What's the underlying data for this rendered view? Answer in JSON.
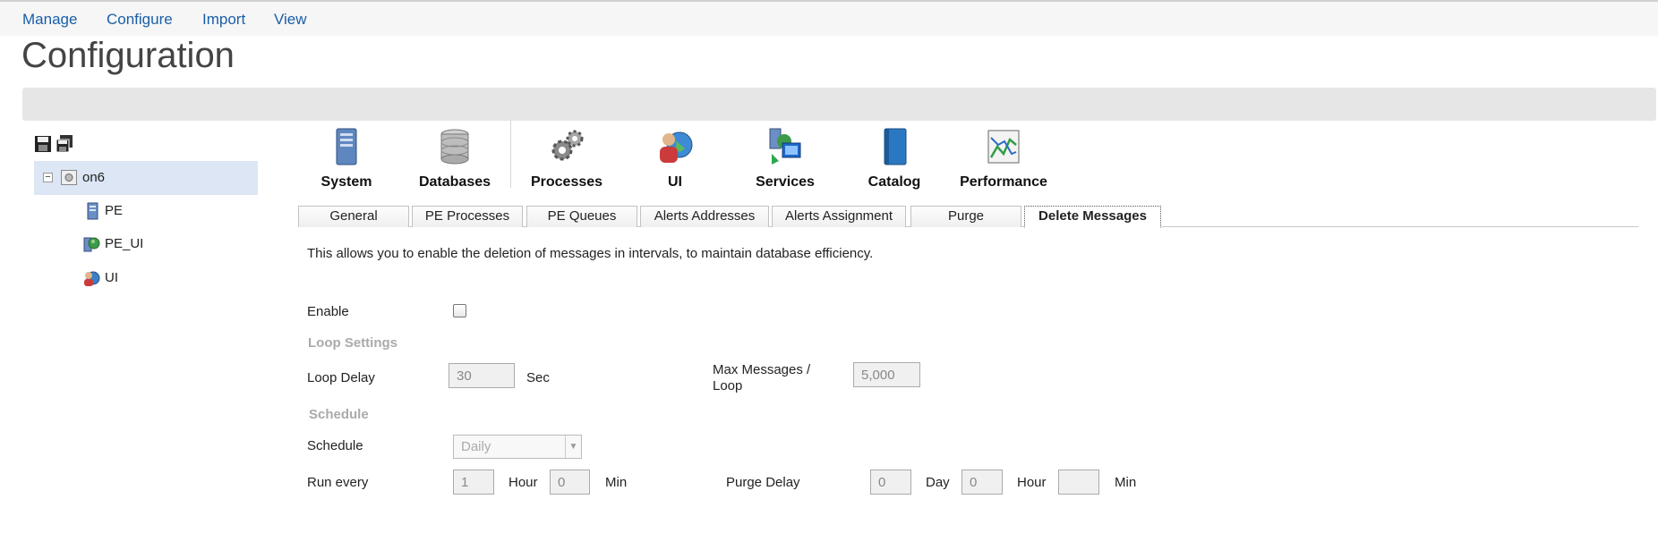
{
  "menu": [
    "Manage",
    "Configure",
    "Import",
    "View"
  ],
  "page_title": "Configuration",
  "tree": {
    "root": "on6",
    "children": [
      "PE",
      "PE_UI",
      "UI"
    ]
  },
  "categories": [
    "System",
    "Databases",
    "Processes",
    "UI",
    "Services",
    "Catalog",
    "Performance"
  ],
  "tabs": [
    "General",
    "PE Processes",
    "PE Queues",
    "Alerts Addresses",
    "Alerts Assignment",
    "Purge",
    "Delete Messages"
  ],
  "active_tab": "Delete Messages",
  "description": "This allows you to enable the deletion of messages in intervals, to maintain database efficiency.",
  "form": {
    "enable_label": "Enable",
    "loop_section": "Loop Settings",
    "loop_delay_label": "Loop Delay",
    "loop_delay_value": "30",
    "sec_label": "Sec",
    "max_messages_label_1": "Max Messages /",
    "max_messages_label_2": "Loop",
    "max_messages_value": "5,000",
    "schedule_section": "Schedule",
    "schedule_label": "Schedule",
    "schedule_value": "Daily",
    "run_every_label": "Run every",
    "run_every_hour": "1",
    "hour_label": "Hour",
    "run_every_min": "0",
    "min_label": "Min",
    "purge_delay_label": "Purge Delay",
    "purge_day": "0",
    "day_label": "Day",
    "purge_hour": "0",
    "purge_hour_label": "Hour",
    "purge_min": "",
    "purge_min_label": "Min"
  },
  "colors": {
    "link": "#1a5ea8",
    "selected_tree": "#dce6f4",
    "band": "#e6e6e6"
  }
}
